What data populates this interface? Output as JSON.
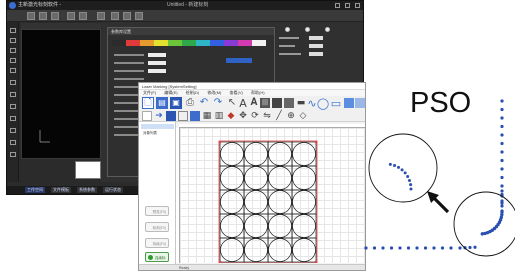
{
  "dark_window": {
    "app_name": "主新激光标刻软件 -",
    "title_center": "Untitled - 新建标刻",
    "status_tabs": [
      "工作空间",
      "文件模板",
      "系统参数",
      "运行状态"
    ]
  },
  "param_dialog": {
    "title": "参数库设置",
    "swatch_colors": [
      "#2b2b2b",
      "#e03a3a",
      "#e69b2d",
      "#e3e02f",
      "#6bc63a",
      "#2fa84a",
      "#2fb5c8",
      "#3360e0",
      "#8a3ad6",
      "#d43ab0",
      "#f2f2f2"
    ]
  },
  "light_window": {
    "title": "Laser Marking [SystemSetting]",
    "menu": [
      "文件(F)",
      "编辑(E)",
      "绘制(D)",
      "修改(M)",
      "查看(V)",
      "帮助(H)"
    ],
    "tree_item": "对象列表",
    "side_buttons": [
      "预览(F3)",
      "标刻(F2)",
      "持续(F4)"
    ],
    "green_button": "连续标刻",
    "status_text": "Ready"
  },
  "illustration": {
    "label": "PSO"
  },
  "colors": {
    "accent_blue": "#2a4fb0",
    "dark_bg": "#2b2b2b",
    "light_bg": "#f3f3f3",
    "selection_red": "#e04848"
  },
  "icons": [
    "logo-icon",
    "new-file-icon",
    "save-icon",
    "print-icon",
    "undo-icon",
    "text-A-icon",
    "line-icon",
    "circle-icon",
    "arrow-icon"
  ]
}
